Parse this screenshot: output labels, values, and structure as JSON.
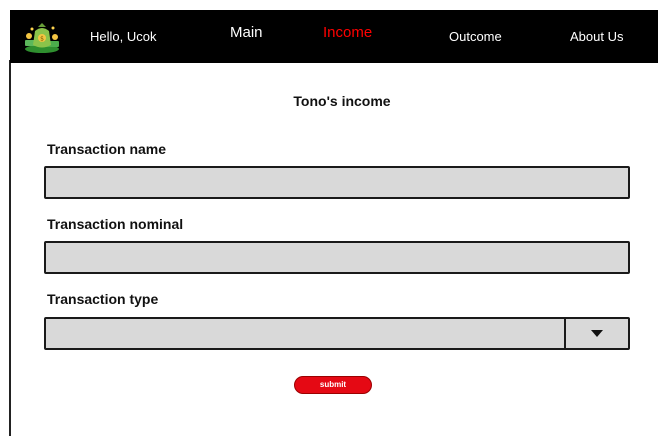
{
  "nav": {
    "greeting": "Hello, Ucok",
    "items": [
      {
        "label": "Main",
        "active": false
      },
      {
        "label": "Income",
        "active": true
      },
      {
        "label": "Outcome",
        "active": false
      },
      {
        "label": "About Us",
        "active": false
      }
    ],
    "logo_icon": "money-bag-icon",
    "active_color": "#ff0000",
    "bar_color": "#000000"
  },
  "page": {
    "title": "Tono's income"
  },
  "form": {
    "transaction_name": {
      "label": "Transaction name",
      "value": "",
      "placeholder": ""
    },
    "transaction_nominal": {
      "label": "Transaction nominal",
      "value": "",
      "placeholder": ""
    },
    "transaction_type": {
      "label": "Transaction type",
      "selected": "",
      "icon": "caret-down-icon"
    },
    "submit_label": "submit",
    "submit_color": "#e50914",
    "field_fill": "#d9d9d9"
  }
}
